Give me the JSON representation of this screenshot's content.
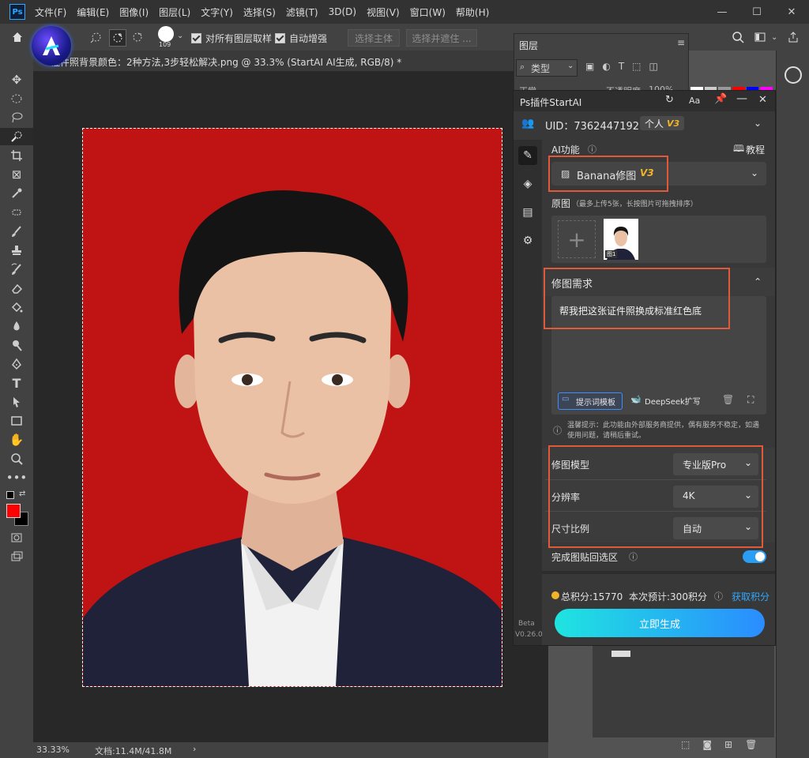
{
  "app": {
    "logo": "Ps"
  },
  "menu": [
    "文件(F)",
    "编辑(E)",
    "图像(I)",
    "图层(L)",
    "文字(Y)",
    "选择(S)",
    "滤镜(T)",
    "3D(D)",
    "视图(V)",
    "窗口(W)",
    "帮助(H)"
  ],
  "window": {
    "minimize": "—",
    "maximize": "☐",
    "close": "✕"
  },
  "options": {
    "brush_size": "109",
    "sample_all_layers": "对所有图层取样",
    "auto_enhance": "自动增强",
    "select_subject": "选择主体",
    "select_and_mask": "选择并遮住 ..."
  },
  "document": {
    "tab_title": "证件照背景颜色：2种方法,3步轻松解决.png @ 33.3% (StartAI AI生成, RGB/8) *",
    "close": "×"
  },
  "status": {
    "zoom": "33.33%",
    "doc_size": "文档:11.4M/41.8M",
    "arrow": "›"
  },
  "layers_panel": {
    "title": "图层",
    "filter_label": "类型",
    "blend_mode": "正常",
    "opacity_label": "不透明度",
    "opacity_value": "100%"
  },
  "plugin": {
    "title": "Ps插件StartAI",
    "uid": "UID：7362447192",
    "account_type": "个人",
    "version_badge": "V3",
    "ai_function_label": "AI功能",
    "tutorial": "教程",
    "function_select": "Banana修图",
    "function_badge": "V3",
    "source_label": "原图",
    "source_hint": "（最多上传5张，长按图片可拖拽排序）",
    "thumb_label": "图1",
    "requirement_label": "修图需求",
    "requirement_text": "帮我把这张证件照换成标准红色底",
    "prompt_template": "提示词模板",
    "deepseek": "DeepSeek扩写",
    "notice": "温馨提示：此功能由外部服务商提供，偶有服务不稳定，如遇使用问题，请稍后重试。",
    "model_label": "修图模型",
    "model_value": "专业版Pro",
    "resolution_label": "分辨率",
    "resolution_value": "4K",
    "ratio_label": "尺寸比例",
    "ratio_value": "自动",
    "paste_back_label": "完成图贴回选区",
    "paste_back_on": true,
    "total_points": "总积分:15770",
    "estimated": "本次预计:300积分",
    "get_points": "获取积分",
    "generate": "立即生成",
    "beta": "Beta",
    "version": "V0.26.0"
  },
  "colors": {
    "accent": "#31a8ff",
    "highlight_red": "#e05a3a",
    "badge_gold": "#f0b429",
    "gen_start": "#1fe4e0",
    "gen_end": "#2a8cff",
    "photo_bg": "#c01414"
  }
}
